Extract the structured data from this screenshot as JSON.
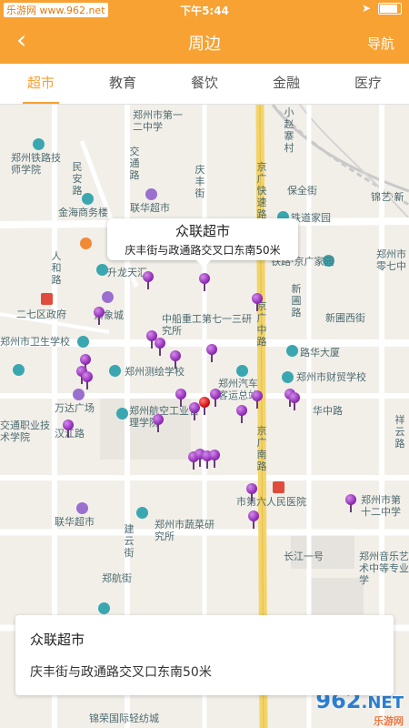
{
  "status_bar": {
    "left_text": "乐游网 www.962.net",
    "time": "下午5:44"
  },
  "nav": {
    "title": "周边",
    "action": "导航"
  },
  "tabs": [
    {
      "label": "超市",
      "active": true
    },
    {
      "label": "教育",
      "active": false
    },
    {
      "label": "餐饮",
      "active": false
    },
    {
      "label": "金融",
      "active": false
    },
    {
      "label": "医疗",
      "active": false
    }
  ],
  "callout": {
    "name": "众联超市",
    "address": "庆丰街与政通路交叉口东南50米"
  },
  "info_card": {
    "name": "众联超市",
    "address": "庆丰街与政通路交叉口东南50米"
  },
  "map_labels": [
    "郑州市第一二中学",
    "郑州铁路技师学院",
    "民安路",
    "交通路",
    "金海商务楼",
    "联华超市",
    "保全街",
    "锦艺·新",
    "铁道家园",
    "人和路",
    "升龙天汇",
    "铁路·京广家园",
    "郑州市零七中",
    "二七区政府",
    "紫象城",
    "中船重工第七一三研究所",
    "新圃西街",
    "郑州市卫生学校",
    "路华大厦",
    "郑州测绘学校",
    "郑州汽车客运总站",
    "郑州市财贸学校",
    "华中路",
    "万达广场",
    "汉江路",
    "交通职业技术学院",
    "郑州航空工业管理学院",
    "市第六人民医院",
    "郑州市第十二中学",
    "联华超市",
    "建云街",
    "郑州市蔬菜研究所",
    "长江一号",
    "郑州音乐艺术中等专业学",
    "郑航街",
    "祥云路",
    "京广快速路",
    "庆丰街",
    "京广中路",
    "京广南路",
    "小赵寨村",
    "新圃路",
    "锦荣国际轻纺城"
  ],
  "watermark": {
    "logo_text": "962",
    "logo_suffix": ".NET",
    "logo_sub": "乐游网"
  },
  "colors": {
    "accent": "#f7a233",
    "pin": "#8a22b0",
    "selected_pin": "#cc0000"
  }
}
